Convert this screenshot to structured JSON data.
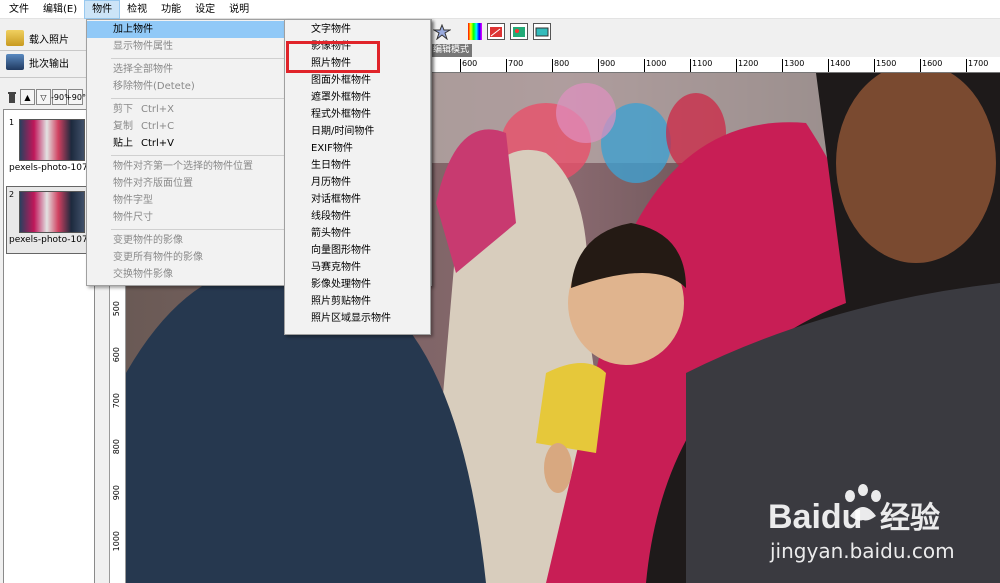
{
  "menubar": {
    "items": [
      "文件",
      "编辑(E)",
      "物件",
      "检视",
      "功能",
      "设定",
      "说明"
    ]
  },
  "left": {
    "load_photo": "载入照片",
    "batch_output": "批次输出",
    "rotate_buttons": [
      "▲",
      "▽",
      "-90°",
      "+90°"
    ],
    "thumbs": [
      {
        "num": "1",
        "caption": "pexels-photo-107..."
      },
      {
        "num": "2",
        "caption": "pexels-photo-107..."
      }
    ]
  },
  "object_menu": {
    "items": [
      {
        "label": "加上物件",
        "shortcut": "",
        "state": "highlight"
      },
      {
        "label": "显示物件属性",
        "shortcut": "",
        "state": "disabled"
      },
      {
        "label": "选择全部物件",
        "shortcut": "",
        "state": "disabled"
      },
      {
        "label": "移除物件(Detete)",
        "shortcut": "",
        "state": "disabled"
      },
      {
        "label": "剪下",
        "shortcut": "Ctrl+X",
        "state": "disabled"
      },
      {
        "label": "复制",
        "shortcut": "Ctrl+C",
        "state": "disabled"
      },
      {
        "label": "贴上",
        "shortcut": "Ctrl+V",
        "state": "enabled"
      },
      {
        "label": "物件对齐第一个选择的物件位置",
        "shortcut": "",
        "state": "disabled"
      },
      {
        "label": "物件对齐版面位置",
        "shortcut": "",
        "state": "disabled"
      },
      {
        "label": "物件字型",
        "shortcut": "",
        "state": "disabled"
      },
      {
        "label": "物件尺寸",
        "shortcut": "",
        "state": "disabled"
      },
      {
        "label": "变更物件的影像",
        "shortcut": "",
        "state": "disabled"
      },
      {
        "label": "变更所有物件的影像",
        "shortcut": "",
        "state": "disabled"
      },
      {
        "label": "交换物件影像",
        "shortcut": "",
        "state": "disabled"
      }
    ],
    "submenu_arrow": ">"
  },
  "add_object_submenu": {
    "items": [
      "文字物件",
      "影像物件",
      "照片物件",
      "图面外框物件",
      "遮罩外框物件",
      "程式外框物件",
      "日期/时间物件",
      "EXIF物件",
      "生日物件",
      "月历物件",
      "对话框物件",
      "线段物件",
      "箭头物件",
      "向量图形物件",
      "马赛克物件",
      "影像处理物件",
      "照片剪贴物件",
      "照片区域显示物件"
    ]
  },
  "ruler": {
    "mode_label": "编辑模式",
    "h_ticks": [
      "600",
      "700",
      "800",
      "900",
      "1000",
      "1100",
      "1200",
      "1300",
      "1400",
      "1500",
      "1600",
      "1700"
    ],
    "v_ticks": [
      "500",
      "600",
      "700",
      "800",
      "900",
      "1000"
    ]
  },
  "watermark": {
    "brand": "Baidu",
    "brand_cn": "经验",
    "url": "jingyan.baidu.com"
  },
  "colors": {
    "highlight": "#91c9f7",
    "red_box": "#e0242a",
    "menu_bg": "#f2f2f2"
  }
}
